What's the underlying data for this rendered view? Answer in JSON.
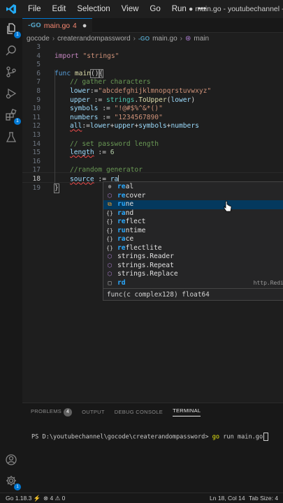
{
  "menu": [
    "File",
    "Edit",
    "Selection",
    "View",
    "Go",
    "Run",
    "•••"
  ],
  "window_title": "● main.go - youtubechannel - V",
  "activity": {
    "explorer_badge": "1",
    "extensions_badge": "1"
  },
  "tab": {
    "icon": "-GO",
    "name": "main.go",
    "count": "4",
    "close": "●"
  },
  "breadcrumb": [
    "gocode",
    "createrandompassword",
    "main.go",
    "main"
  ],
  "breadcrumb_go_icon": "-GO",
  "editor": {
    "line_numbers": [
      "3",
      "4",
      "5",
      "6",
      "7",
      "8",
      "9",
      "10",
      "11",
      "12",
      "13",
      "14",
      "15",
      "16",
      "17",
      "18",
      "19"
    ],
    "lines": {
      "l4": [
        "import ",
        "\"strings\""
      ],
      "l6": [
        "func ",
        "main",
        "()",
        "{"
      ],
      "l7": "// gather characters",
      "l8": [
        "lower",
        ":=",
        "\"abcdefghijklmnopqrstuvwxyz\""
      ],
      "l9": [
        "upper",
        " := ",
        "strings",
        ".",
        "ToUpper",
        "(",
        "lower",
        ")"
      ],
      "l10": [
        "symbols",
        " := ",
        "\"!@#$%^&*()\""
      ],
      "l11": [
        "numbers",
        " := ",
        "\"1234567890\""
      ],
      "l12": [
        "all",
        ":=",
        "lower",
        "+",
        "upper",
        "+",
        "symbols",
        "+",
        "numbers"
      ],
      "l14": "// set password length",
      "l15": [
        "length",
        " := ",
        "6"
      ],
      "l17": "//random generator",
      "l18": [
        "source",
        " := ",
        "ra"
      ],
      "l19": "}"
    }
  },
  "suggestions": [
    {
      "icon": "⊚",
      "match": "re",
      "rest": "al"
    },
    {
      "icon": "⬡",
      "match": "re",
      "rest": "cover"
    },
    {
      "icon": "⧉",
      "match": "ru",
      "rest": "ne"
    },
    {
      "icon": "{}",
      "match": "ra",
      "rest": "nd"
    },
    {
      "icon": "{}",
      "match": "re",
      "rest": "flect"
    },
    {
      "icon": "{}",
      "match": "ru",
      "rest": "ntime"
    },
    {
      "icon": "{}",
      "match": "ra",
      "rest": "ce"
    },
    {
      "icon": "{}",
      "match": "re",
      "rest": "flectlite"
    },
    {
      "icon": "⬡",
      "match": "",
      "rest": "strings.Reader"
    },
    {
      "icon": "⬡",
      "match": "",
      "rest": "strings.Repeat"
    },
    {
      "icon": "⬡",
      "match": "",
      "rest": "strings.Replace"
    },
    {
      "icon": "□",
      "match": "rd",
      "rest": "",
      "detail": "http.Redi"
    }
  ],
  "suggest_detail": "func(c complex128) float64",
  "panel": {
    "tabs": [
      "PROBLEMS",
      "OUTPUT",
      "DEBUG CONSOLE",
      "TERMINAL"
    ],
    "problems_count": "4",
    "terminal_prompt": "PS D:\\youtubechannel\\gocode\\createrandompassword> ",
    "terminal_cmd": "go",
    "terminal_args": " run main.go"
  },
  "status": {
    "go_version": "Go 1.18.3",
    "errors": "⊗ 4",
    "warnings": "⚠ 0",
    "position": "Ln 18, Col 14",
    "tab_size": "Tab Size: 4"
  }
}
